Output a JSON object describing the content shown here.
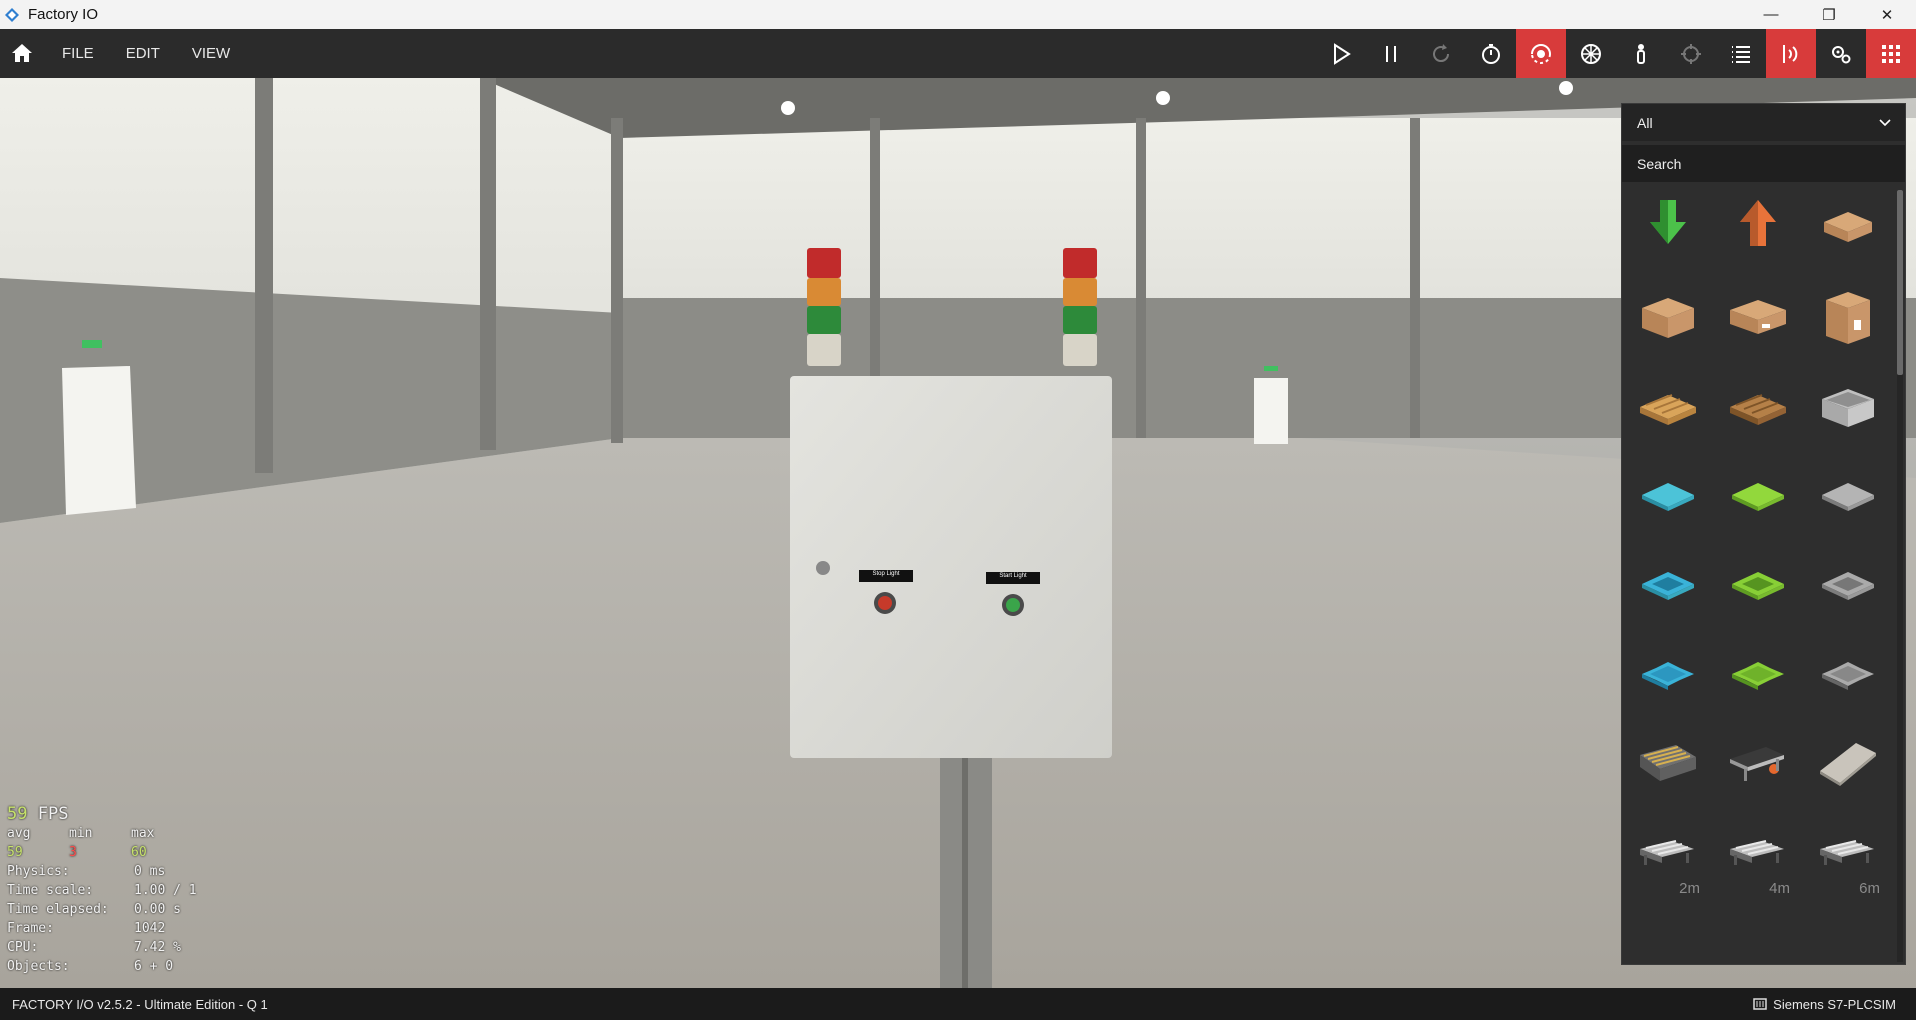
{
  "window": {
    "title": "Factory IO",
    "minimize": "—",
    "restore": "❐",
    "close": "✕"
  },
  "menu": [
    "FILE",
    "EDIT",
    "VIEW"
  ],
  "toolbar": {
    "tools": [
      {
        "name": "play-icon",
        "active": false
      },
      {
        "name": "pause-icon",
        "active": false
      },
      {
        "name": "reset-icon",
        "active": false
      },
      {
        "name": "timer-icon",
        "active": false
      },
      {
        "name": "orbit-camera-icon",
        "active": true
      },
      {
        "name": "fly-camera-icon",
        "active": false
      },
      {
        "name": "first-person-icon",
        "active": false
      },
      {
        "name": "target-icon",
        "active": false
      },
      {
        "name": "list-icon",
        "active": false
      },
      {
        "name": "sensors-icon",
        "active": true
      },
      {
        "name": "drivers-icon",
        "active": false
      },
      {
        "name": "palette-grid-icon",
        "active": true
      }
    ]
  },
  "scene": {
    "stop_label": "Stop Light",
    "start_label": "Start Light"
  },
  "stats": {
    "fps": "59",
    "fps_unit": "FPS",
    "headers": [
      "avg",
      "min",
      "max"
    ],
    "avg": "59",
    "min": "3",
    "max": "60",
    "rows": [
      {
        "k": "Physics:",
        "v": "0 ms"
      },
      {
        "k": "Time scale:",
        "v": "1.00 / 1"
      },
      {
        "k": "Time elapsed:",
        "v": "0.00 s"
      },
      {
        "k": "Frame:",
        "v": "1042"
      },
      {
        "k": "CPU:",
        "v": "7.42 %"
      },
      {
        "k": "Objects:",
        "v": "6 + 0"
      }
    ]
  },
  "palette": {
    "filter": "All",
    "search_placeholder": "Search",
    "items": [
      {
        "name": "remover-icon"
      },
      {
        "name": "emitter-icon"
      },
      {
        "name": "small-box-icon"
      },
      {
        "name": "medium-box-icon"
      },
      {
        "name": "flat-box-icon"
      },
      {
        "name": "large-box-icon"
      },
      {
        "name": "pallet-icon"
      },
      {
        "name": "dark-pallet-icon"
      },
      {
        "name": "stackable-box-icon"
      },
      {
        "name": "blue-raw-material-icon"
      },
      {
        "name": "green-raw-material-icon"
      },
      {
        "name": "metal-raw-material-icon"
      },
      {
        "name": "blue-product-base-icon"
      },
      {
        "name": "green-product-base-icon"
      },
      {
        "name": "metal-product-base-icon"
      },
      {
        "name": "blue-product-lid-icon"
      },
      {
        "name": "green-product-lid-icon"
      },
      {
        "name": "metal-product-lid-icon"
      },
      {
        "name": "roller-conveyor-icon"
      },
      {
        "name": "belt-conveyor-icon"
      },
      {
        "name": "floor-plate-icon"
      },
      {
        "name": "roller-conveyor-2m-icon",
        "label": "2m"
      },
      {
        "name": "roller-conveyor-4m-icon",
        "label": "4m"
      },
      {
        "name": "roller-conveyor-6m-icon",
        "label": "6m"
      }
    ]
  },
  "status": {
    "version": "FACTORY I/O v2.5.2 - Ultimate Edition - Q 1",
    "driver": "Siemens S7-PLCSIM"
  },
  "colors": {
    "accent": "#d83b3b",
    "toolbar": "#2b2b2b",
    "fps": "#c6e26b"
  }
}
